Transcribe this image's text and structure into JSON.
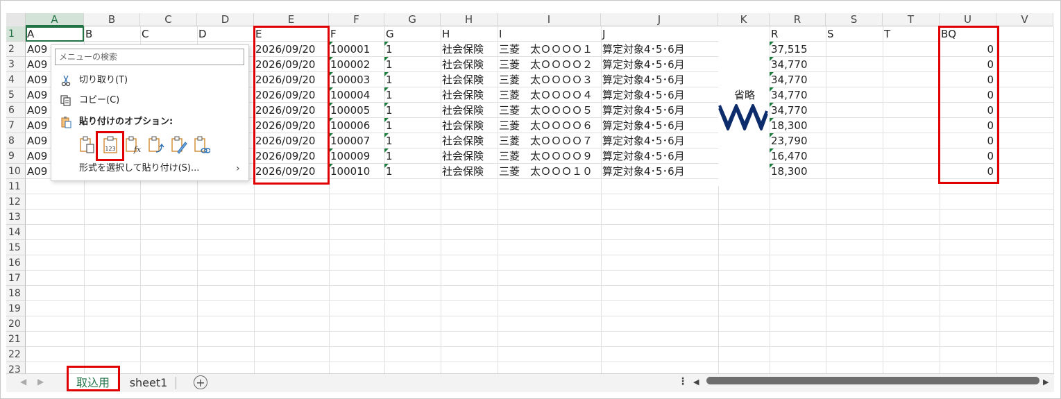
{
  "columns": [
    "A",
    "B",
    "C",
    "D",
    "E",
    "F",
    "G",
    "H",
    "I",
    "J",
    "K",
    "R",
    "S",
    "T",
    "U",
    "V"
  ],
  "rows": [
    "1",
    "2",
    "3",
    "4",
    "5",
    "6",
    "7",
    "8",
    "9",
    "10",
    "11",
    "12",
    "13",
    "14",
    "15",
    "16",
    "17",
    "18",
    "19",
    "20",
    "21",
    "22",
    "23"
  ],
  "header_row": {
    "A": "A",
    "B": "B",
    "C": "C",
    "D": "D",
    "E": "E",
    "F": "F",
    "G": "G",
    "H": "H",
    "I": "I",
    "J": "J",
    "R": "R",
    "S": "S",
    "T": "T",
    "U": "BQ"
  },
  "data_rows": [
    {
      "A": "A09",
      "E": "2026/09/20",
      "F": "100001",
      "G": "1",
      "H": "社会保険",
      "I": "三菱　太ＯＯＯＯ１",
      "J": "算定対象4･5･6月",
      "R": "37,515",
      "U": "0"
    },
    {
      "A": "A09",
      "E": "2026/09/20",
      "F": "100002",
      "G": "1",
      "H": "社会保険",
      "I": "三菱　太ＯＯＯＯ２",
      "J": "算定対象4･5･6月",
      "R": "34,770",
      "U": "0"
    },
    {
      "A": "A09",
      "E": "2026/09/20",
      "F": "100003",
      "G": "1",
      "H": "社会保険",
      "I": "三菱　太ＯＯＯＯ３",
      "J": "算定対象4･5･6月",
      "R": "34,770",
      "U": "0"
    },
    {
      "A": "A09",
      "E": "2026/09/20",
      "F": "100004",
      "G": "1",
      "H": "社会保険",
      "I": "三菱　太ＯＯＯＯ４",
      "J": "算定対象4･5･6月",
      "R": "34,770",
      "U": "0"
    },
    {
      "A": "A09",
      "E": "2026/09/20",
      "F": "100005",
      "G": "1",
      "H": "社会保険",
      "I": "三菱　太ＯＯＯＯ５",
      "J": "算定対象4･5･6月",
      "R": "34,770",
      "U": "0"
    },
    {
      "A": "A09",
      "E": "2026/09/20",
      "F": "100006",
      "G": "1",
      "H": "社会保険",
      "I": "三菱　太ＯＯＯＯ６",
      "J": "算定対象4･5･6月",
      "R": "18,300",
      "U": "0"
    },
    {
      "A": "A09",
      "E": "2026/09/20",
      "F": "100007",
      "G": "1",
      "H": "社会保険",
      "I": "三菱　太ＯＯＯＯ７",
      "J": "算定対象4･5･6月",
      "R": "23,790",
      "U": "0"
    },
    {
      "A": "A09",
      "E": "2026/09/20",
      "F": "100009",
      "G": "1",
      "H": "社会保険",
      "I": "三菱　太ＯＯＯＯ９",
      "J": "算定対象4･5･6月",
      "R": "16,470",
      "U": "0"
    },
    {
      "A": "A09",
      "E": "2026/09/20",
      "F": "100010",
      "G": "1",
      "H": "社会保険",
      "I": "三菱　太ＯＯＯ１０",
      "J": "算定対象4･5･6月",
      "R": "18,300",
      "U": "0"
    }
  ],
  "omitted_label": "省略",
  "context_menu": {
    "search_placeholder": "メニューの検索",
    "cut": "切り取り(T)",
    "copy": "コピー(C)",
    "paste_options": "貼り付けのオプション:",
    "paste_special": "形式を選択して貼り付け(S)..."
  },
  "sheet_tabs": [
    "取込用",
    "sheet1"
  ],
  "add_sheet": "+",
  "colors": {
    "accent": "#217346",
    "highlight": "#e00000",
    "wave": "#0d2c6b"
  }
}
